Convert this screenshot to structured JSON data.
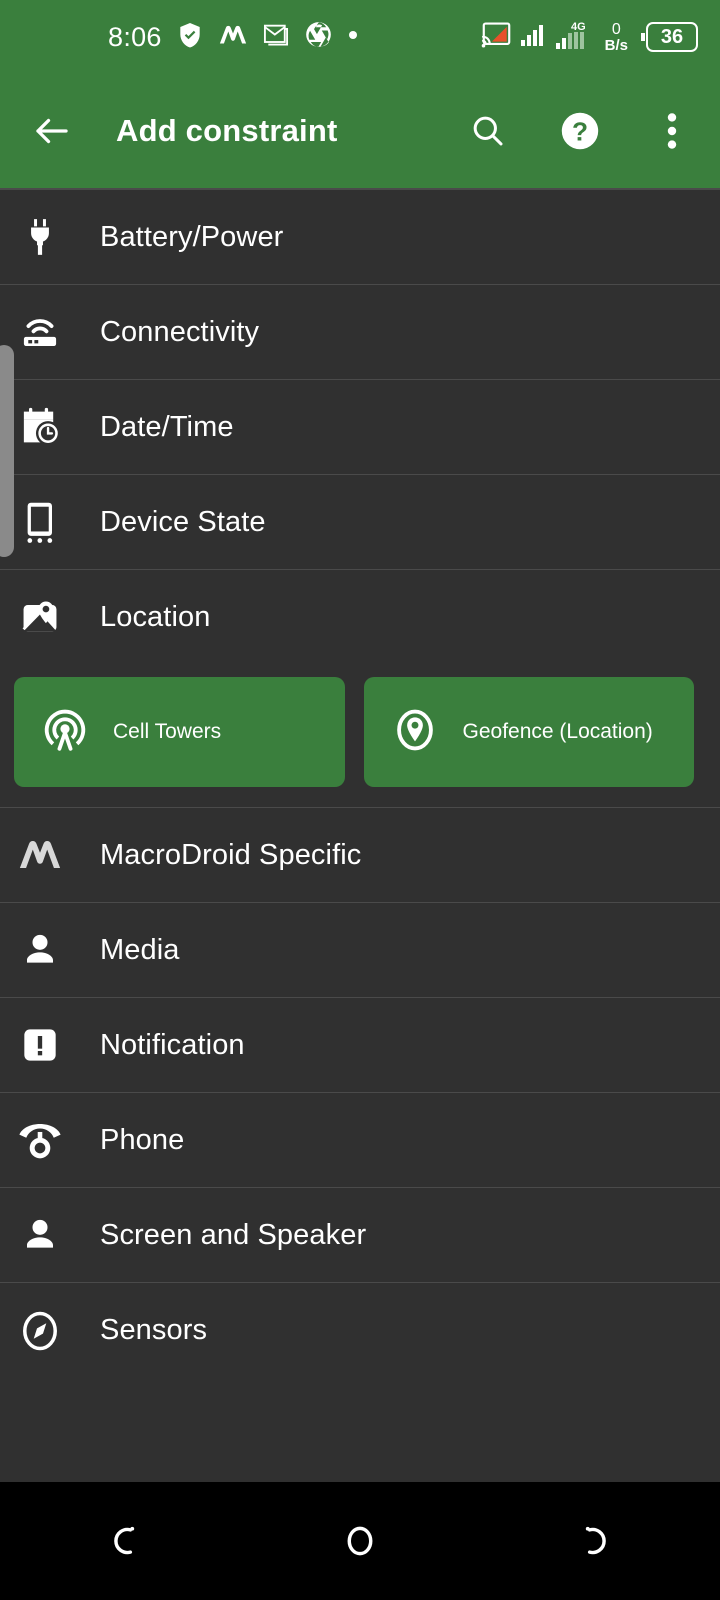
{
  "status_bar": {
    "time": "8:06",
    "left_icons": [
      "shield-check-icon",
      "macrodroid-icon",
      "gmail-icon",
      "camera-aperture-icon",
      "dot-icon"
    ],
    "right_icons": [
      "cast-icon",
      "signal-bars-icon",
      "signal-bars-4g-icon"
    ],
    "network_type": "4G",
    "data_rate_value": "0",
    "data_rate_unit": "B/s",
    "battery_percent": "36"
  },
  "app_bar": {
    "back_label": "back-arrow",
    "title": "Add constraint",
    "search_label": "search",
    "help_label": "help",
    "overflow_label": "more options"
  },
  "colors": {
    "accent_green": "#3a7f3d",
    "background": "#303030",
    "divider": "#4a4a4a",
    "text_primary": "#ffffff",
    "nav_background": "#000000",
    "cast_orange": "#e8502b",
    "scroll_handle": "#8a8a8a"
  },
  "list": {
    "items": [
      {
        "label": "Battery/Power",
        "icon": "power-plug-icon"
      },
      {
        "label": "Connectivity",
        "icon": "router-wifi-icon"
      },
      {
        "label": "Date/Time",
        "icon": "calendar-clock-icon"
      },
      {
        "label": "Device State",
        "icon": "smartphone-icon"
      },
      {
        "label": "Location",
        "icon": "map-pin-icon"
      },
      {
        "label": "MacroDroid Specific",
        "icon": "macrodroid-logo-icon"
      },
      {
        "label": "Media",
        "icon": "person-icon"
      },
      {
        "label": "Notification",
        "icon": "notification-alert-icon"
      },
      {
        "label": "Phone",
        "icon": "rotary-phone-icon"
      },
      {
        "label": "Screen and Speaker",
        "icon": "person-icon"
      },
      {
        "label": "Sensors",
        "icon": "compass-icon"
      }
    ]
  },
  "expanded_group": {
    "parent": "Location",
    "chips": [
      {
        "label": "Cell Towers",
        "icon": "cell-tower-icon"
      },
      {
        "label": "Geofence (Location)",
        "icon": "geofence-pin-icon"
      }
    ]
  },
  "nav_bar": {
    "back_label": "back",
    "home_label": "home",
    "recents_label": "recents"
  }
}
